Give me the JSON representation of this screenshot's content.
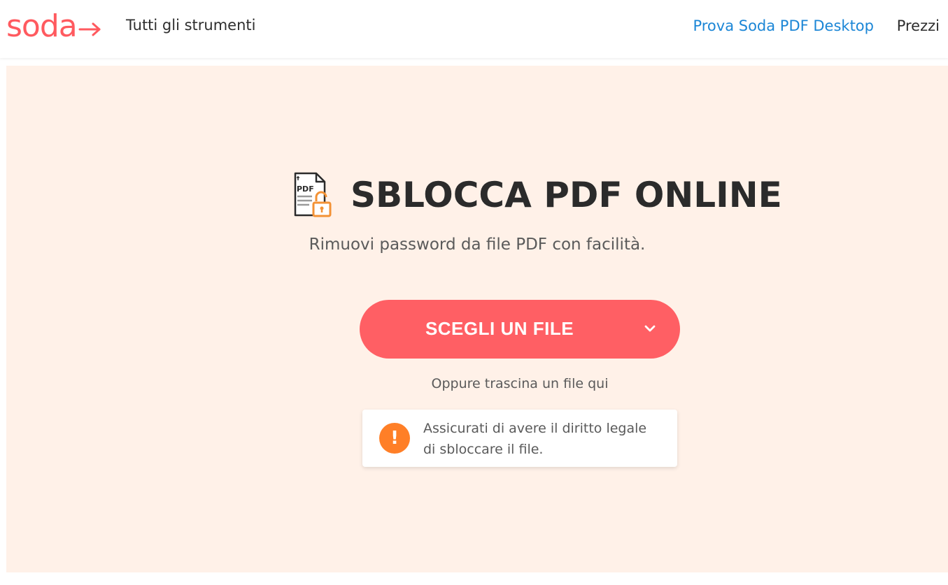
{
  "header": {
    "logo_text": "soda",
    "nav_tools": "Tutti gli strumenti",
    "nav_desktop": "Prova Soda PDF Desktop",
    "nav_pricing": "Prezzi"
  },
  "hero": {
    "icon_label": "PDF",
    "title": "SBLOCCA PDF ONLINE",
    "subtitle": "Rimuovi password da file PDF con facilità.",
    "choose_button": "SCEGLI UN FILE",
    "drop_hint": "Oppure trascina un file qui",
    "notice_icon_symbol": "!",
    "notice_text": "Assicurati di avere il diritto legale di sbloccare il file."
  },
  "colors": {
    "brand": "#ff5a5f",
    "button": "#ff5f64",
    "link": "#1b86d6",
    "hero_bg": "#fff1e8",
    "warning": "#ff7f27"
  },
  "icons": {
    "logo_arrow": "arrow-right-icon",
    "file": "pdf-unlock-icon",
    "chevron": "chevron-down-icon",
    "warning": "exclamation-icon"
  }
}
